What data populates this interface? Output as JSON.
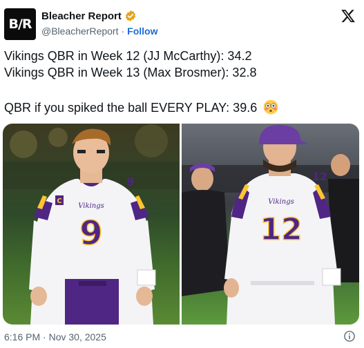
{
  "account": {
    "avatar_text_left": "B",
    "avatar_text_slash": "/",
    "avatar_text_right": "R",
    "display_name": "Bleacher Report",
    "handle": "@BleacherReport",
    "separator": "·",
    "follow_label": "Follow",
    "verified_icon": "verified-badge-gold",
    "brand_color": "#0b0b0b",
    "verified_color": "#e8a317"
  },
  "post": {
    "line1": "Vikings QBR in Week 12 (JJ McCarthy): 34.2",
    "line2": "Vikings QBR in Week 13 (Max Brosmer): 32.8",
    "line3": "QBR if you spiked the ball EVERY PLAY: 39.6",
    "emoji": "flushed-face-emoji"
  },
  "media": {
    "left_photo": {
      "jersey_number": "9",
      "team_wordmark": "Vikings",
      "shoulder_number": "9"
    },
    "right_photo": {
      "jersey_number": "12",
      "team_wordmark": "Vikings",
      "shoulder_number": "12"
    },
    "purple": "#4f2683",
    "gold": "#ffc62f"
  },
  "footer": {
    "timestamp": "6:16 PM · Nov 30, 2025",
    "info_icon": "info-icon"
  },
  "colors": {
    "text_primary": "#0f1419",
    "text_secondary": "#536471",
    "link": "#1d6ad6"
  }
}
